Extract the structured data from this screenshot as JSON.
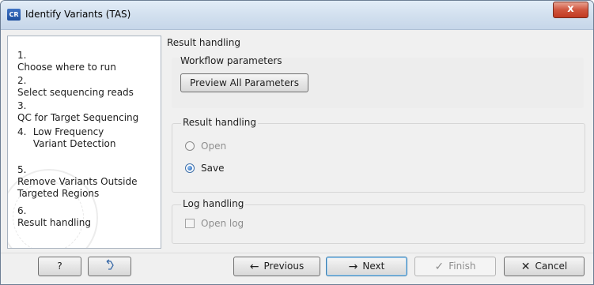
{
  "window": {
    "app_icon_text": "CR",
    "title": "Identify Variants (TAS)",
    "close_glyph": "x"
  },
  "steps": [
    {
      "number": "1.",
      "label": "Choose where to run"
    },
    {
      "number": "2.",
      "label": "Select sequencing reads"
    },
    {
      "number": "3.",
      "label": "QC for Target Sequencing"
    },
    {
      "number": "4.",
      "label": "Low Frequency Variant Detection"
    },
    {
      "number": "5.",
      "label": "Remove Variants Outside Targeted Regions"
    },
    {
      "number": "6.",
      "label": "Result handling"
    }
  ],
  "main": {
    "header": "Result handling",
    "workflow_group": {
      "label": "Workflow parameters",
      "preview_button": "Preview All Parameters"
    },
    "result_group": {
      "label": "Result handling",
      "options": [
        {
          "label": "Open",
          "selected": false,
          "enabled": false
        },
        {
          "label": "Save",
          "selected": true,
          "enabled": true
        }
      ]
    },
    "log_group": {
      "label": "Log handling",
      "open_log": "Open log",
      "checked": false
    }
  },
  "footer": {
    "help": "?",
    "previous": "Previous",
    "next": "Next",
    "finish": "Finish",
    "cancel": "Cancel"
  },
  "icons": {
    "previous": "arrow-left-icon",
    "next": "arrow-right-icon",
    "finish": "checkmark-icon",
    "cancel": "x-icon",
    "reset": "undo-icon"
  }
}
